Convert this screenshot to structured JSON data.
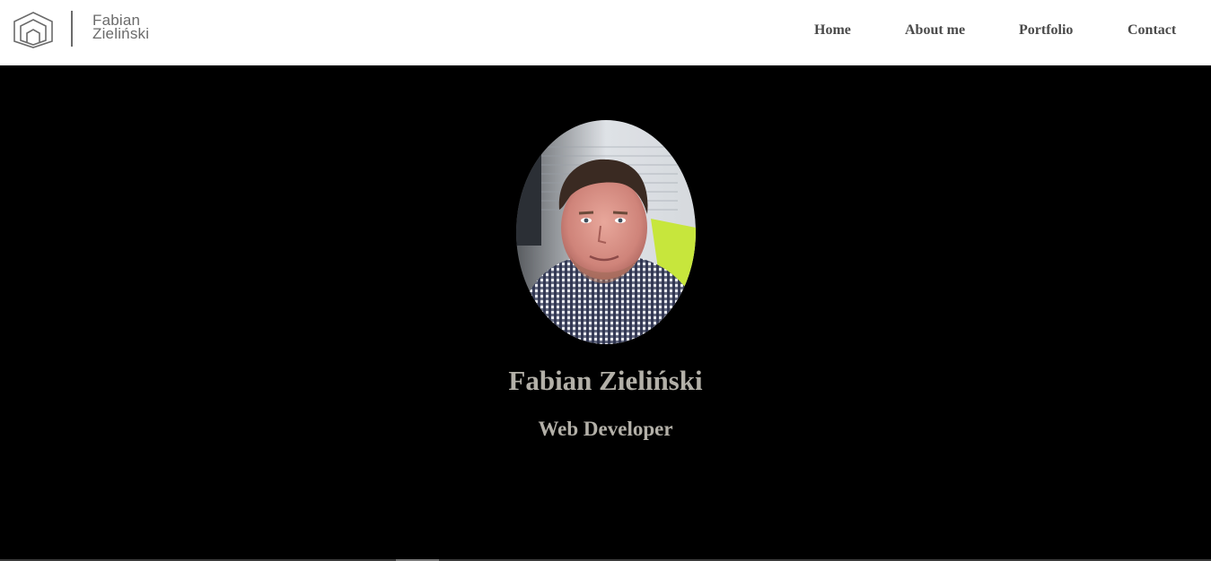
{
  "header": {
    "brand_line1": "Fabian",
    "brand_line2": "Zieliński",
    "logo_icon": "hexagon-house-icon"
  },
  "nav": {
    "items": [
      {
        "label": "Home"
      },
      {
        "label": "About me"
      },
      {
        "label": "Portfolio"
      },
      {
        "label": "Contact"
      }
    ]
  },
  "hero": {
    "avatar_alt": "portrait-photo",
    "name": "Fabian Zieliński",
    "role": "Web Developer"
  },
  "colors": {
    "header_bg": "#ffffff",
    "hero_bg": "#000000",
    "hero_text": "#b3b0a8",
    "nav_text": "#4a4a4a",
    "brand_text": "#6b6b6b"
  }
}
